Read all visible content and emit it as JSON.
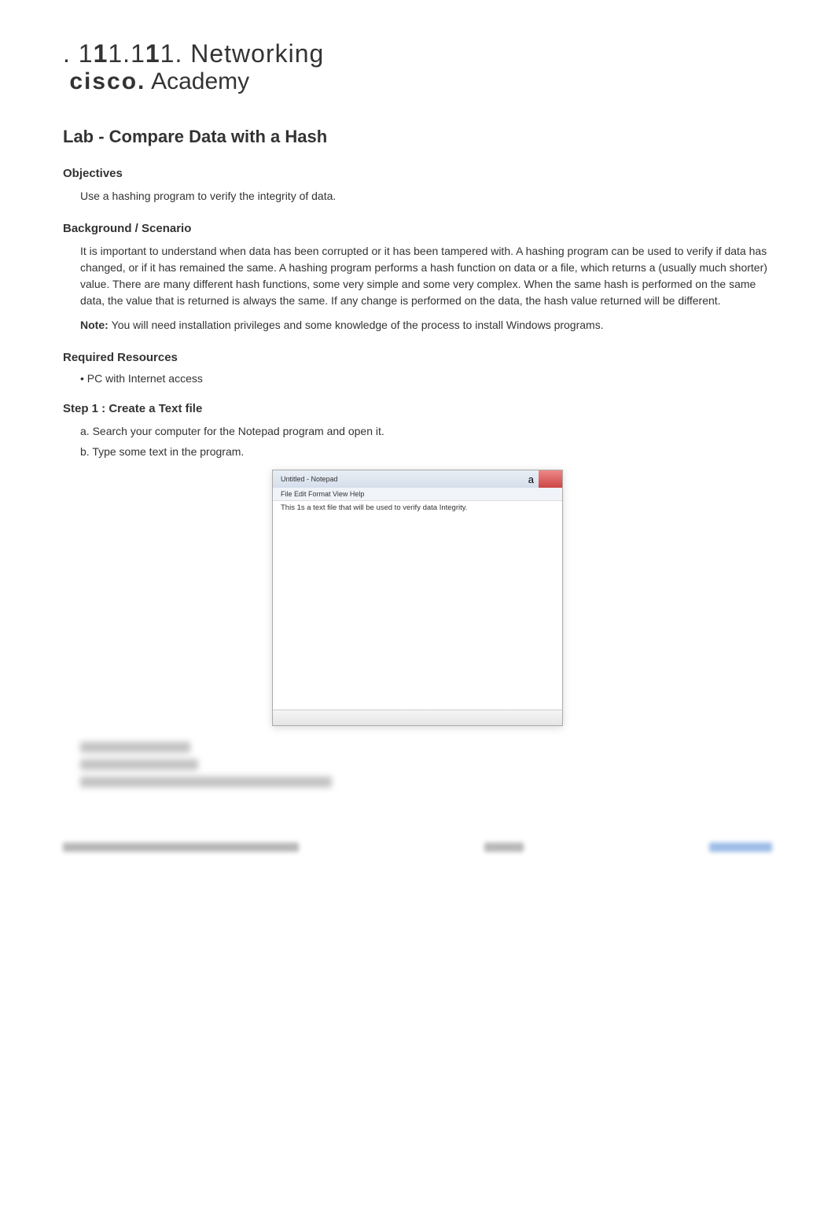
{
  "header": {
    "line1_prefix": ". 1",
    "line1_bold1": "1",
    "line1_mid": "1.1",
    "line1_bold2": "1",
    "line1_suffix": "1. Networking",
    "cisco": "cisco.",
    "academy": " Academy"
  },
  "lab_title": "Lab - Compare Data with a Hash",
  "objectives": {
    "heading": "Objectives",
    "text": "Use a hashing program to verify the integrity of data."
  },
  "background": {
    "heading": "Background / Scenario",
    "text": "It is important to understand when data has been corrupted or it has been tampered with. A hashing program can be used to verify if data has changed, or if it has remained the same. A hashing program performs a hash function on data or a file, which returns a (usually much shorter) value. There are many different hash functions, some very simple and some very complex. When the same hash is performed on the same data, the value that is returned is always the same. If any change is performed on the data, the hash value returned will be different.",
    "note_label": "Note: ",
    "note_text": "You will need installation privileges and some knowledge of the process to install Windows programs."
  },
  "resources": {
    "heading": "Required Resources",
    "bullet": "• PC with Internet access"
  },
  "step1": {
    "heading": "Step 1 : Create a Text file",
    "item_a": "a. Search your computer for the Notepad program and open it.",
    "item_b": "b. Type some text in the program."
  },
  "notepad": {
    "title": "Untitled - Notepad",
    "a_label": "a",
    "menu": "File Edit Format View Help",
    "content": "This 1s a text file that will be used to verify data Integrity."
  }
}
